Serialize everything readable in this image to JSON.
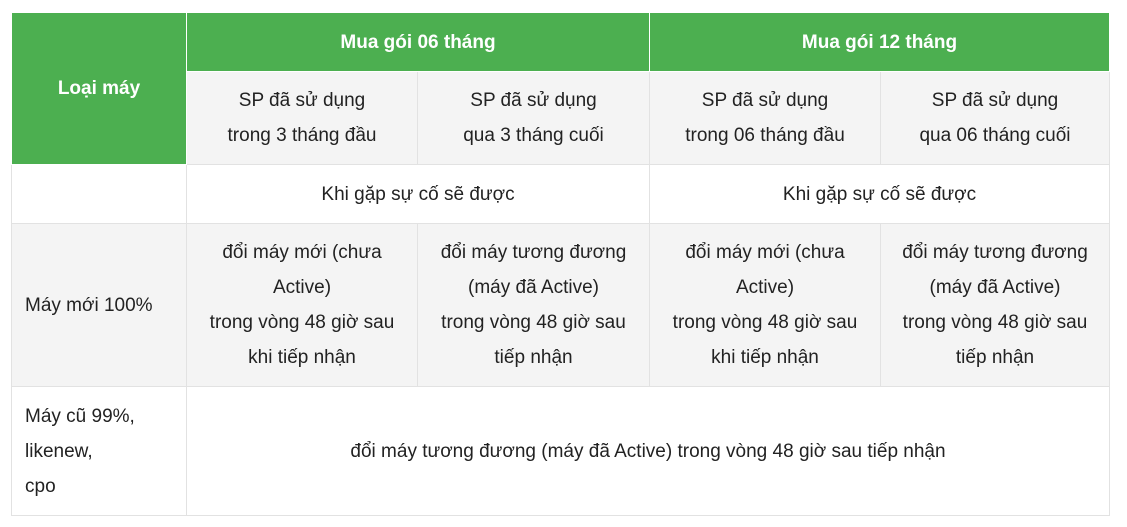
{
  "table": {
    "header": {
      "corner": "Loại máy",
      "group_6": "Mua gói 06 tháng",
      "group_12": "Mua gói 12 tháng"
    },
    "subheaders": [
      [
        "SP đã sử dụng",
        "trong 3 tháng đầu"
      ],
      [
        "SP đã sử dụng",
        "qua 3 tháng cuối"
      ],
      [
        "SP đã sử dụng",
        "trong 06 tháng đầu"
      ],
      [
        "SP đã sử dụng",
        "qua 06 tháng cuối"
      ]
    ],
    "info_row": {
      "label": "",
      "group_6": "Khi gặp sự cố sẽ được",
      "group_12": "Khi gặp sự cố sẽ được"
    },
    "rows": {
      "new": {
        "label": "Máy mới 100%",
        "cells": [
          [
            "đổi máy mới (chưa",
            "Active)",
            "trong vòng 48 giờ sau",
            "khi tiếp nhận"
          ],
          [
            "đổi máy tương đương",
            "(máy đã Active)",
            "trong vòng 48 giờ sau",
            "tiếp nhận"
          ],
          [
            "đổi máy mới (chưa",
            "Active)",
            "trong vòng 48 giờ sau",
            "khi tiếp nhận"
          ],
          [
            "đổi máy tương đương",
            "(máy đã Active)",
            "trong vòng 48 giờ sau",
            "tiếp nhận"
          ]
        ]
      },
      "old": {
        "label": [
          "Máy cũ 99%,",
          "likenew,",
          "cpo"
        ],
        "cell": "đổi máy tương đương (máy đã Active) trong vòng 48 giờ sau tiếp nhận"
      }
    },
    "colors": {
      "header_bg": "#4caf50",
      "header_text": "#ffffff",
      "stripe_bg": "#f4f4f4",
      "border": "#e2e2e2"
    }
  }
}
